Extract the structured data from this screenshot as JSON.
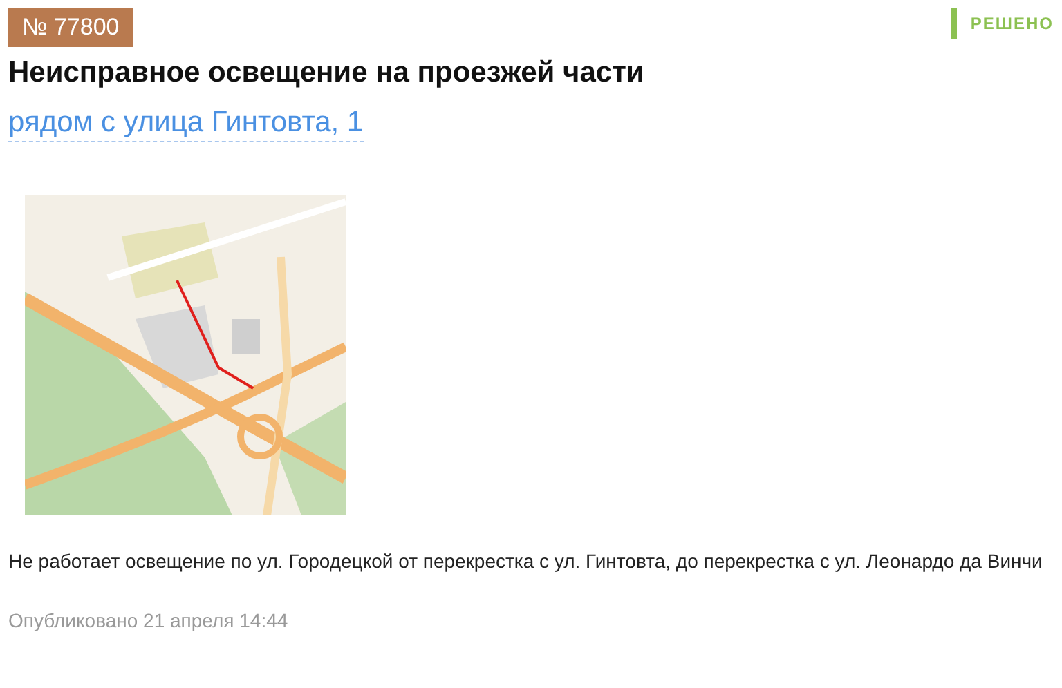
{
  "issue": {
    "number": "№ 77800",
    "status": {
      "label": "РЕШЕНО",
      "kind": "resolved"
    },
    "title": "Неисправное освещение на проезжей части",
    "address": "рядом с улица Гинтовта, 1"
  },
  "description": "Не работает освещение по ул. Городецкой от перекрестка с ул. Гинтовта, до перекрестка с ул. Леонардо да Винчи",
  "published": "Опубликовано 21 апреля 14:44"
}
